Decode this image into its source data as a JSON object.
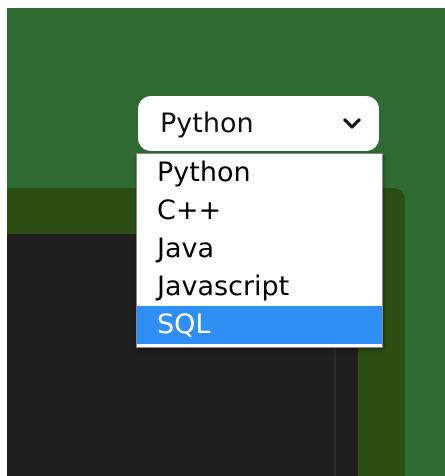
{
  "language_select": {
    "current_value": "Python",
    "options": [
      "Python",
      "C++",
      "Java",
      "Javascript",
      "SQL"
    ],
    "highlighted_option": "SQL",
    "highlight_color": "#2f8ff5"
  },
  "colors": {
    "background_green": "#2f6a32",
    "panel_green": "#2b4f12",
    "editor_dark": "#1f1f1f"
  },
  "icons": {
    "select_chevron": "chevron-down-icon"
  }
}
